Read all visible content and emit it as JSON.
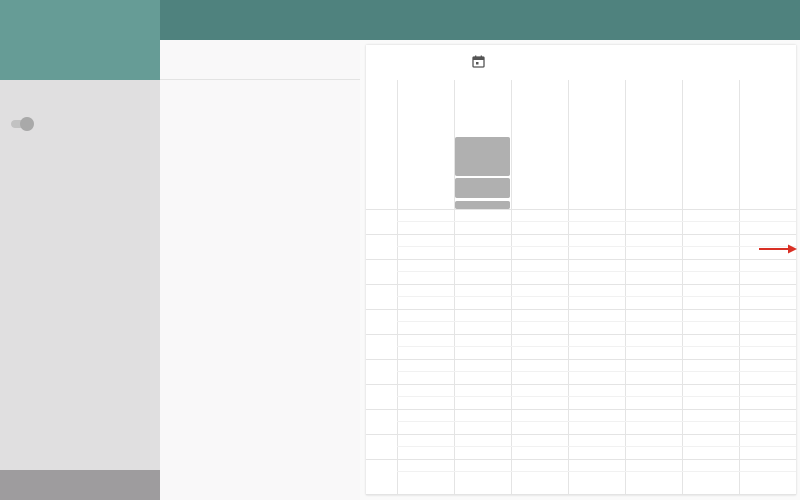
{
  "colors": {
    "sidebar_header": "#669c96",
    "topbar": "#4f827e",
    "sidebar": "#e0dfe0",
    "sidebar_footer": "#9e9c9e",
    "block": "#b0b0b0",
    "arrow": "#d93025"
  },
  "sidebar": {
    "toggle": {
      "state": "off"
    }
  },
  "calendar": {
    "icon": "calendar-icon",
    "day_columns": 7,
    "time_rows": 11,
    "events": 3
  },
  "overlay": {
    "arrow": "arrow-right-icon"
  }
}
